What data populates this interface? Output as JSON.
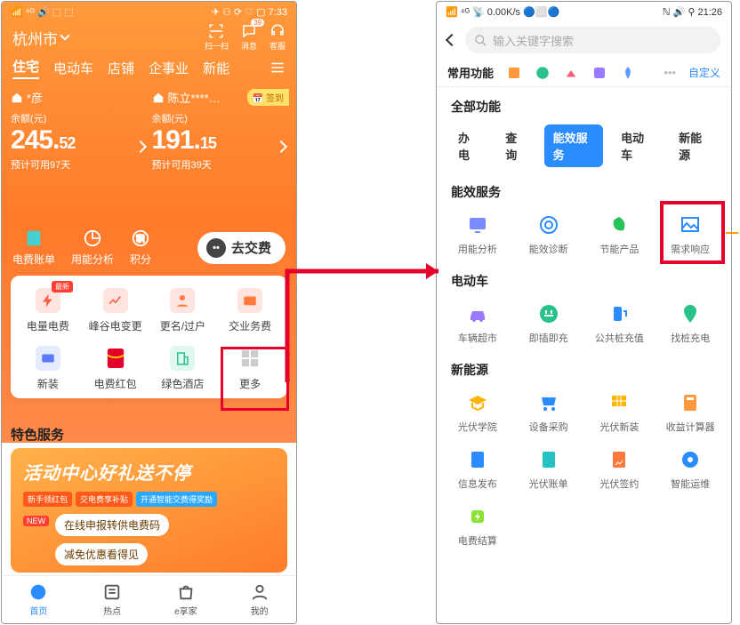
{
  "left": {
    "status": {
      "left": "📶 ⁴ᴳ 🔊 ⬚ ⬚",
      "right": "✈ ⚇ ⟳ ♡ ▢ 7:33"
    },
    "city": "杭州市",
    "header_icons": {
      "scan": "扫一扫",
      "msg": "消息",
      "msg_badge": "39",
      "cs": "客服"
    },
    "tabs": [
      "住宅",
      "电动车",
      "店铺",
      "企事业",
      "新能"
    ],
    "cards": [
      {
        "name": "*彦",
        "bal_label": "余额(元)",
        "amount_main": "245.",
        "amount_dec": "52",
        "estimate": "预计可用97天"
      },
      {
        "name": "陈立****…",
        "bal_label": "余额(元)",
        "amount_main": "191.",
        "amount_dec": "15",
        "estimate": "预计可用39天",
        "signin": "📅 签到"
      }
    ],
    "quick": {
      "bill": "电费账单",
      "usage": "用能分析",
      "points": "积分",
      "pay": "去交费"
    },
    "grid": [
      {
        "label": "电量电费",
        "badge": "最新"
      },
      {
        "label": "峰谷电变更"
      },
      {
        "label": "更名/过户"
      },
      {
        "label": "交业务费"
      },
      {
        "label": "新装"
      },
      {
        "label": "电费红包"
      },
      {
        "label": "绿色酒店"
      },
      {
        "label": "更多"
      }
    ],
    "special_title": "特色服务",
    "promo": {
      "headline": "活动中心好礼送不停",
      "pills": [
        "新手领红包",
        "交电费享补贴",
        "开通智能交费得奖励"
      ],
      "new": "NEW",
      "line1": "在线申报转供电费码",
      "line2": "减免优惠看得见"
    },
    "nav": [
      "首页",
      "热点",
      "e享家",
      "我的"
    ]
  },
  "right": {
    "status": {
      "left": "📶 ⁴ᴳ 📡 0.00K/s 🔵⬜🔵",
      "right": "ℕ 🔊 ⚲ 21:26"
    },
    "search_placeholder": "输入关键字搜索",
    "freq_title": "常用功能",
    "freq_custom": "自定义",
    "all_title": "全部功能",
    "tabs": [
      "办电",
      "查询",
      "能效服务",
      "电动车",
      "新能源"
    ],
    "sections": [
      {
        "title": "能效服务",
        "items": [
          "用能分析",
          "能效诊断",
          "节能产品",
          "需求响应"
        ]
      },
      {
        "title": "电动车",
        "items": [
          "车辆超市",
          "即插即充",
          "公共桩充值",
          "找桩充电"
        ]
      },
      {
        "title": "新能源",
        "items": [
          "光伏学院",
          "设备采购",
          "光伏新装",
          "收益计算器",
          "信息发布",
          "光伏账单",
          "光伏签约",
          "智能运维",
          "电费结算"
        ]
      }
    ]
  }
}
